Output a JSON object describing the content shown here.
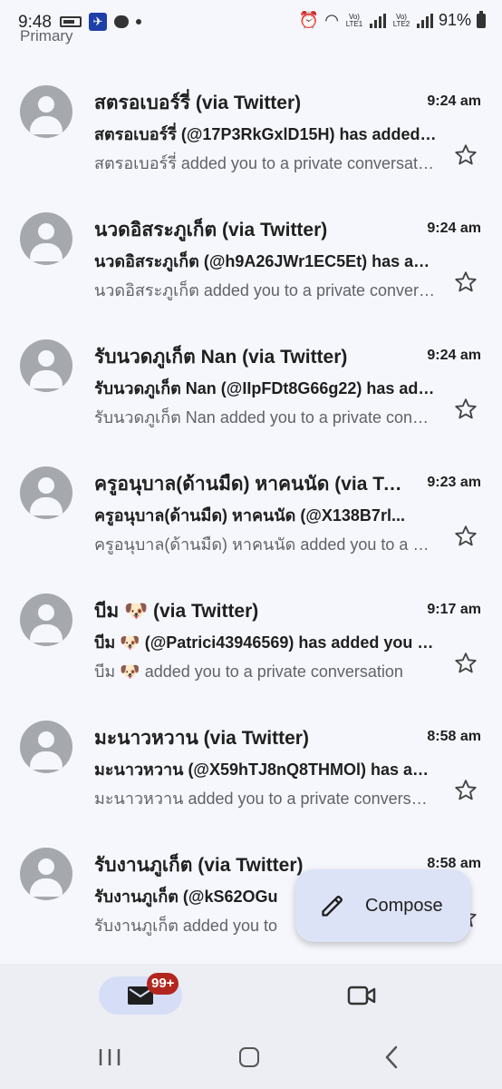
{
  "status_bar": {
    "time": "9:48",
    "lte1": "Vo) LTE1",
    "lte2": "Vo) LTE2",
    "battery": "91%"
  },
  "section_label": "Primary",
  "emails": [
    {
      "sender": "สตรอเบอร์รี่ (via Twitter)",
      "time": "9:24 am",
      "subject": "สตรอเบอร์รี่ (@17P3RkGxlD15H) has added you to a private conversation",
      "snippet": "สตรอเบอร์รี่ added you to a private conversation"
    },
    {
      "sender": "นวดอิสระภูเก็ต (via Twitter)",
      "time": "9:24 am",
      "subject": "นวดอิสระภูเก็ต (@h9A26JWr1EC5Et) has added you to a private conversation",
      "snippet": "นวดอิสระภูเก็ต added you to a private conversation"
    },
    {
      "sender": "รับนวดภูเก็ต Nan (via Twitter)",
      "time": "9:24 am",
      "subject": "รับนวดภูเก็ต Nan (@IIpFDt8G66g22) has added you to a private conversation",
      "snippet": "รับนวดภูเก็ต Nan added you to a private conversation"
    },
    {
      "sender": "ครูอนุบาล(ด้านมืด) หาคนนัด (via Twitter)",
      "time": "9:23 am",
      "subject": "ครูอนุบาล(ด้านมืด) หาคนนัด (@X138B7rl...",
      "snippet": "ครูอนุบาล(ด้านมืด) หาคนนัด added you to a private conversation"
    },
    {
      "sender": "บีม 🐶 (via Twitter)",
      "time": "9:17 am",
      "subject": "บีม 🐶 (@Patrici43946569) has added you to a private conversation",
      "snippet": "บีม 🐶 added you to a private conversation"
    },
    {
      "sender": "มะนาวหวาน (via Twitter)",
      "time": "8:58 am",
      "subject": "มะนาวหวาน (@X59hTJ8nQ8THMOl) has added you to a private conversation",
      "snippet": "มะนาวหวาน added you to a private conversation"
    },
    {
      "sender": "รับงานภูเก็ต (via Twitter)",
      "time": "8:58 am",
      "subject": "รับงานภูเก็ต (@kS62OGu",
      "snippet": "รับงานภูเก็ต added you to"
    }
  ],
  "compose": {
    "label": "Compose",
    "icon": "pencil-icon"
  },
  "bottom_nav": {
    "mail_badge": "99+",
    "mail_icon": "mail-icon",
    "meet_icon": "video-camera-icon"
  },
  "colors": {
    "background": "#f6f7fc",
    "compose_bg": "#dde3f6",
    "badge": "#b3261e",
    "nav_bg": "#eceef4"
  }
}
